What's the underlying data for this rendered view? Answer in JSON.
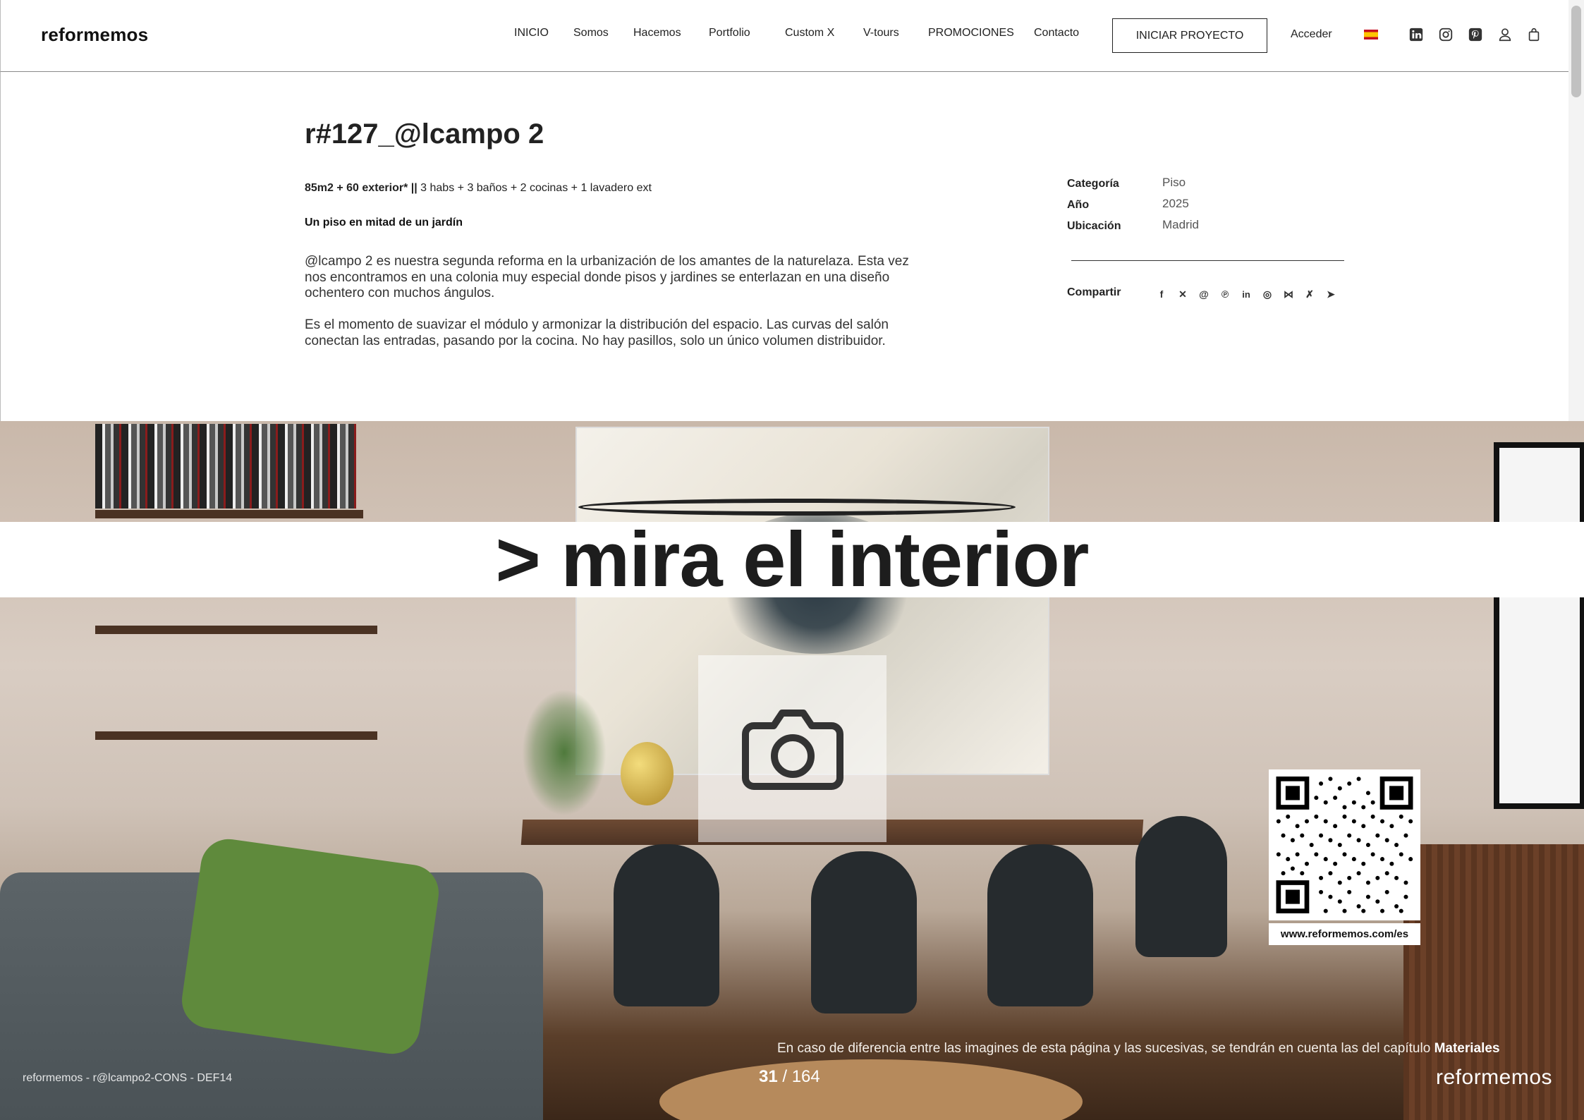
{
  "header": {
    "logo": "reformemos",
    "nav": [
      {
        "label": "INICIO"
      },
      {
        "label": "Somos"
      },
      {
        "label": "Hacemos"
      },
      {
        "label": "Portfolio"
      },
      {
        "label": "Custom X"
      },
      {
        "label": "V-tours"
      },
      {
        "label": "PROMOCIONES"
      },
      {
        "label": "Contacto"
      }
    ],
    "cta_label": "INICIAR PROYECTO",
    "login_label": "Acceder",
    "language": "es-flag-icon",
    "icons": [
      "linkedin-icon",
      "instagram-icon",
      "pinterest-icon",
      "user-icon",
      "bag-icon"
    ]
  },
  "project": {
    "title": "r#127_@lcampo 2",
    "specs_bold": "85m2 + 60 exterior* ||",
    "specs_rest": " 3 habs + 3 baños + 2 cocinas + 1 lavadero ext",
    "tagline": "Un piso en mitad de un jardín",
    "paragraphs": [
      "@lcampo 2 es nuestra segunda reforma en la urbanización de los amantes de la naturelaza. Esta vez nos encontramos en una colonia muy especial donde pisos y jardines se enterlazan en una diseño ochentero con muchos ángulos.",
      "Es el momento de suavizar el  módulo y armonizar la distribución del espacio. Las curvas del salón conectan las entradas, pasando por la cocina. No hay pasillos, solo un único volumen distribuidor."
    ]
  },
  "meta": {
    "rows": [
      {
        "key": "Categoría",
        "value": "Piso"
      },
      {
        "key": "Año",
        "value": "2025"
      },
      {
        "key": "Ubicación",
        "value": "Madrid"
      }
    ],
    "share_label": "Compartir",
    "share_icons": [
      "facebook-icon",
      "x-icon",
      "threads-icon",
      "pinterest-icon",
      "linkedin-icon",
      "whatsapp-icon",
      "bluesky-icon",
      "xing-icon",
      "telegram-icon"
    ]
  },
  "hero": {
    "banner": "> mira el interior",
    "qr_url": "www.reformemos.com/es",
    "disclaimer_text": "En caso de diferencia entre las imagines de esta página y las sucesivas, se tendrán en cuenta las del capítulo ",
    "disclaimer_bold": "Materiales",
    "page_current": "31",
    "page_total": " / 164",
    "footer_code": "reformemos - r@lcampo2-CONS - DEF14",
    "footer_logo": "reformemos"
  }
}
